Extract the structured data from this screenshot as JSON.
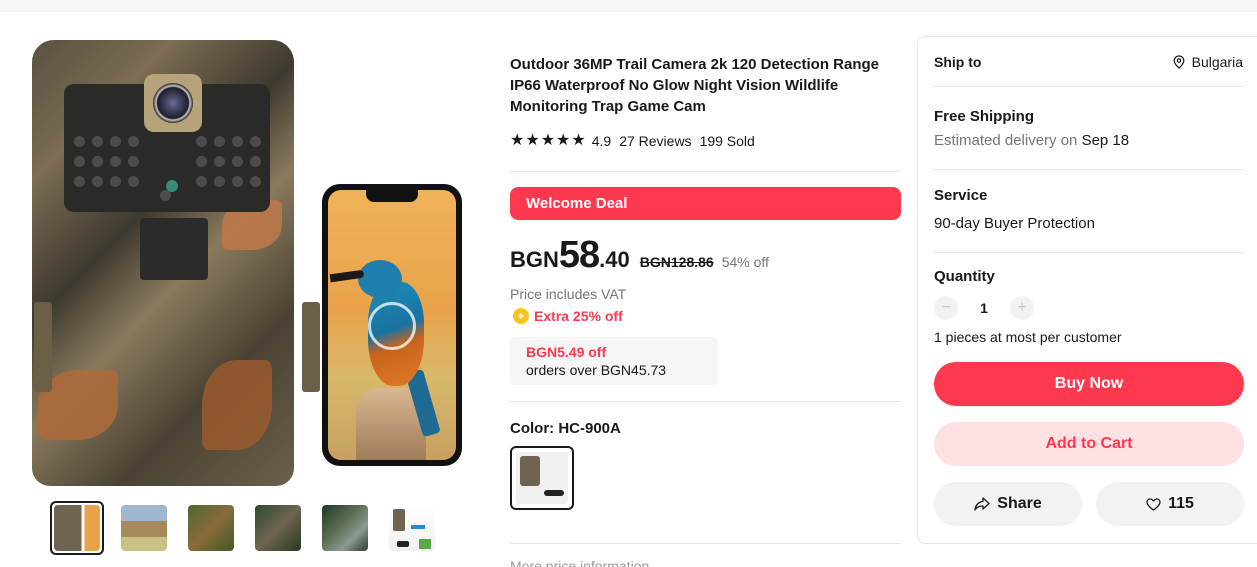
{
  "gallery": {
    "thumbnails": [
      {
        "name": "thumb-1",
        "active": true
      },
      {
        "name": "thumb-2",
        "active": false
      },
      {
        "name": "thumb-3",
        "active": false
      },
      {
        "name": "thumb-4",
        "active": false
      },
      {
        "name": "thumb-5",
        "active": false
      },
      {
        "name": "thumb-6",
        "active": false
      }
    ]
  },
  "product": {
    "title": "Outdoor 36MP Trail Camera 2k 120 Detection Range IP66 Waterproof No Glow Night Vision Wildlife Monitoring Trap Game Cam",
    "rating": "4.9",
    "stars": 5,
    "reviews": "27 Reviews",
    "sold": "199 Sold"
  },
  "deal": {
    "banner": "Welcome Deal"
  },
  "price": {
    "currency": "BGN",
    "integer": "58",
    "decimal": ".40",
    "original": "BGN128.86",
    "discount": "54% off",
    "vat_note": "Price includes VAT",
    "extra": "Extra 25% off"
  },
  "coupon": {
    "amount": "BGN5.49 off",
    "condition": "orders over BGN45.73"
  },
  "variant": {
    "label": "Color: HC-900A"
  },
  "more_info": "More price information",
  "side": {
    "ship_to_label": "Ship to",
    "ship_to_value": "Bulgaria",
    "shipping_title": "Free Shipping",
    "delivery_prefix": "Estimated delivery on ",
    "delivery_date": "Sep 18",
    "service_title": "Service",
    "service_text": "90-day Buyer Protection",
    "quantity_title": "Quantity",
    "quantity_value": "1",
    "quantity_minus": "−",
    "quantity_plus": "+",
    "quantity_note": "1 pieces at most per customer",
    "buy_now": "Buy Now",
    "add_to_cart": "Add to Cart",
    "share": "Share",
    "wishlist_count": "115"
  },
  "colors": {
    "accent": "#fd384f",
    "accent_light": "#ffe0e3",
    "text": "#191919",
    "muted": "#757575"
  }
}
